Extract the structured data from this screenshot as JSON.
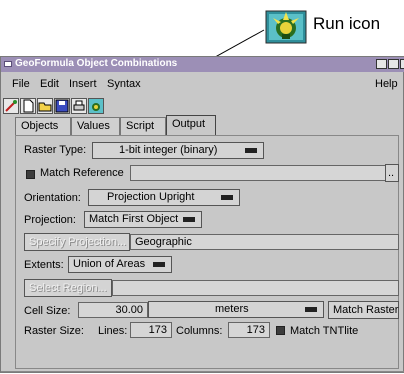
{
  "callout": {
    "label": "Run icon",
    "icon": "run-icon"
  },
  "window": {
    "title": "GeoFormula Object Combinations",
    "accent": "#9c8fb6"
  },
  "menubar": {
    "items": [
      "File",
      "Edit",
      "Insert",
      "Syntax"
    ],
    "help": "Help"
  },
  "toolbar": {
    "icons": [
      "magic-wand-icon",
      "new-file-icon",
      "open-folder-icon",
      "save-icon",
      "print-icon",
      "run-icon"
    ]
  },
  "tabs": [
    "Objects",
    "Values",
    "Script",
    "Output"
  ],
  "active_tab": "Output",
  "form": {
    "raster_type_label": "Raster Type:",
    "raster_type_value": "1-bit integer (binary)",
    "match_reference_label": "Match Reference",
    "match_reference_value": "",
    "browse_label": "..",
    "orientation_label": "Orientation:",
    "orientation_value": "Projection Upright",
    "projection_label": "Projection:",
    "projection_value": "Match First Object",
    "specify_projection_label": "Specify Projection...",
    "projection_text": "Geographic",
    "extents_label": "Extents:",
    "extents_value": "Union of Areas",
    "select_region_label": "Select Region...",
    "region_value": "",
    "cell_size_label": "Cell Size:",
    "cell_size_value": "30.00",
    "cell_size_unit": "meters",
    "match_raster_label": "Match Raster",
    "raster_size_label": "Raster Size:",
    "lines_label": "Lines:",
    "lines_value": "173",
    "columns_label": "Columns:",
    "columns_value": "173",
    "match_tntlite_label": "Match TNTlite"
  }
}
